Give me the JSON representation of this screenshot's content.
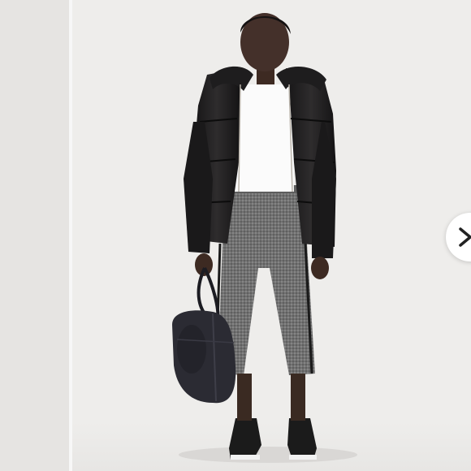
{
  "photo": {
    "subject": "model-photo",
    "icon": "chevron-right-icon",
    "colors": {
      "background": "#eeedeb",
      "jacket": "#1c1b1c",
      "pants": "#6d6d6d",
      "stripe": "#1a1a1a",
      "button": "#ffffff",
      "chevron": "#222222"
    }
  }
}
